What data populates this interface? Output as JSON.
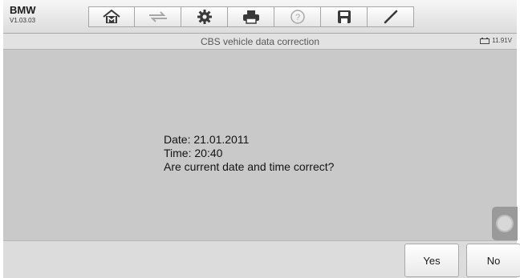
{
  "header": {
    "vehicle": "BMW",
    "version": "V1.03.03"
  },
  "toolbar": {
    "buttons": [
      {
        "icon": "home-icon"
      },
      {
        "icon": "vehicle-swap-icon",
        "disabled": true
      },
      {
        "icon": "gear-icon"
      },
      {
        "icon": "print-icon"
      },
      {
        "icon": "help-icon",
        "disabled": true
      },
      {
        "icon": "save-icon"
      },
      {
        "icon": "pen-icon"
      }
    ]
  },
  "titlebar": {
    "title": "CBS vehicle data correction",
    "battery": "11.91V"
  },
  "message": {
    "date_line": "Date: 21.01.2011",
    "time_line": "Time: 20:40",
    "question": "Are current date and time correct?"
  },
  "actions": {
    "yes_label": "Yes",
    "no_label": "No"
  },
  "colors": {
    "background": "#c9c9c9",
    "toolbar": "#e6e6e6",
    "icon_active": "#3a3a3a",
    "icon_disabled": "#a8a8a8"
  }
}
